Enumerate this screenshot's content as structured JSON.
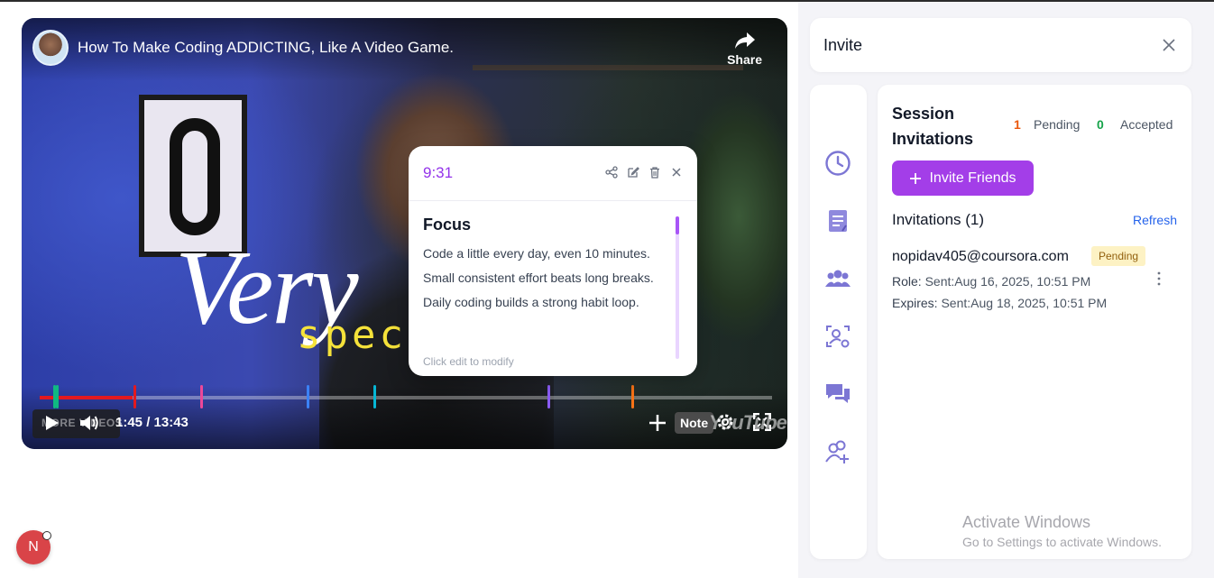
{
  "video": {
    "title": "How To Make Coding ADDICTING, Like A Video Game.",
    "share_label": "Share",
    "overlay_word_1": "Very",
    "overlay_word_2": "spec",
    "more_videos_label": "MORE VIDEOS",
    "time": "1:45 / 13:43",
    "note_label": "Note",
    "youtube_label": "YouTube",
    "progress_fraction": 0.127,
    "markers": [
      {
        "time": "0:15",
        "color": "#10b981"
      },
      {
        "time": "0:18",
        "color": "#10b981"
      },
      {
        "time": "1:45",
        "color": "#e3191f"
      },
      {
        "time": "3:00",
        "color": "#ec4899"
      },
      {
        "time": "5:00",
        "color": "#3b82f6"
      },
      {
        "time": "6:15",
        "color": "#06b6d4"
      },
      {
        "time": "9:31",
        "color": "#8b5cf6"
      },
      {
        "time": "11:05",
        "color": "#f97316"
      }
    ]
  },
  "note": {
    "time": "9:31",
    "title": "Focus",
    "lines": [
      "Code a little every day, even 10 minutes.",
      "Small consistent effort beats long breaks.",
      "Daily coding builds a strong habit loop."
    ],
    "hint": "Click edit to modify"
  },
  "panel": {
    "title": "Invite",
    "session_title": "Session Invitations",
    "pending_count": "1",
    "pending_label": "Pending",
    "accepted_count": "0",
    "accepted_label": "Accepted",
    "invite_button": "Invite Friends",
    "invitations_heading": "Invitations (1)",
    "refresh_label": "Refresh",
    "invitation": {
      "email": "nopidav405@coursora.com",
      "status": "Pending",
      "role_label": "Role:",
      "role_value": "Sent:Aug 16, 2025, 10:51 PM",
      "expires_label": "Expires:",
      "expires_value": "Sent:Aug 18, 2025, 10:51 PM"
    },
    "rail_icons": [
      "clock-icon",
      "notes-icon",
      "group-icon",
      "scan-user-icon",
      "chat-icon",
      "add-user-icon"
    ]
  },
  "watermark": {
    "line1": "Activate Windows",
    "line2": "Go to Settings to activate Windows."
  },
  "user": {
    "initial": "N"
  },
  "colors": {
    "accent": "#a33ee8",
    "note_time": "#9333ea",
    "pending": "#ea580c",
    "accepted": "#16a34a",
    "link": "#2563eb"
  }
}
